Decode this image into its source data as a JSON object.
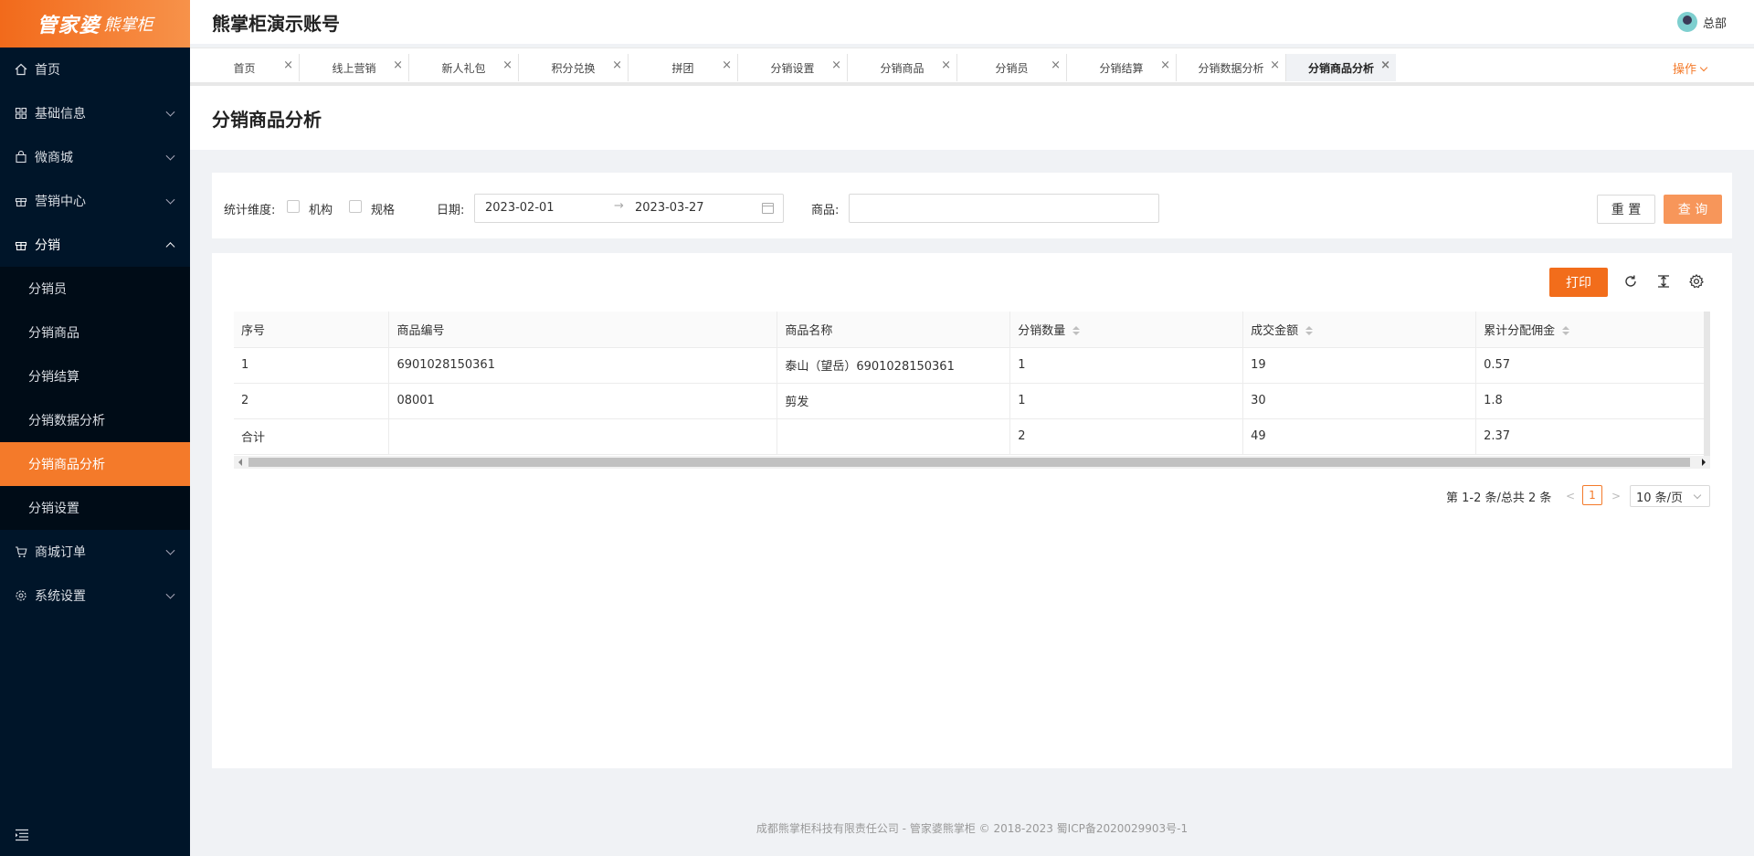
{
  "logo": {
    "brand": "管家婆",
    "product": "熊掌柜"
  },
  "header": {
    "title": "熊掌柜演示账号",
    "user": "总部"
  },
  "sidebar": {
    "items": [
      {
        "label": "首页"
      },
      {
        "label": "基础信息"
      },
      {
        "label": "微商城"
      },
      {
        "label": "营销中心"
      },
      {
        "label": "分销"
      },
      {
        "label": "商城订单"
      },
      {
        "label": "系统设置"
      }
    ],
    "sub_items": [
      {
        "label": "分销员"
      },
      {
        "label": "分销商品"
      },
      {
        "label": "分销结算"
      },
      {
        "label": "分销数据分析"
      },
      {
        "label": "分销商品分析"
      },
      {
        "label": "分销设置"
      }
    ]
  },
  "tabs": [
    {
      "label": "首页"
    },
    {
      "label": "线上营销"
    },
    {
      "label": "新人礼包"
    },
    {
      "label": "积分兑换"
    },
    {
      "label": "拼团"
    },
    {
      "label": "分销设置"
    },
    {
      "label": "分销商品"
    },
    {
      "label": "分销员"
    },
    {
      "label": "分销结算"
    },
    {
      "label": "分销数据分析"
    },
    {
      "label": "分销商品分析"
    }
  ],
  "tab_close": "×",
  "ops_label": "操作",
  "page_title": "分销商品分析",
  "filter": {
    "dimension_label": "统计维度:",
    "opt_org": "机构",
    "opt_spec": "规格",
    "date_label": "日期:",
    "date_start": "2023-02-01",
    "date_arrow": "→",
    "date_end": "2023-03-27",
    "goods_label": "商品:",
    "goods_value": "",
    "reset": "重 置",
    "query": "查 询"
  },
  "toolbar": {
    "print": "打印"
  },
  "table": {
    "headers": [
      "序号",
      "商品编号",
      "商品名称",
      "分销数量",
      "成交金额",
      "累计分配佣金"
    ],
    "rows": [
      [
        "1",
        "6901028150361",
        "泰山（望岳）6901028150361",
        "1",
        "19",
        "0.57"
      ],
      [
        "2",
        "08001",
        "剪发",
        "1",
        "30",
        "1.8"
      ],
      [
        "合计",
        "",
        "",
        "2",
        "49",
        "2.37"
      ]
    ]
  },
  "pagination": {
    "total_text": "第 1-2 条/总共 2 条",
    "prev": "<",
    "current": "1",
    "next": ">",
    "page_size": "10 条/页"
  },
  "footer": "成都熊掌柜科技有限责任公司 - 管家婆熊掌柜 © 2018-2023 蜀ICP备2020029903号-1",
  "colors": {
    "accent": "#f47a2a",
    "sidebar_bg": "#001529",
    "submenu_bg": "#000c17"
  }
}
